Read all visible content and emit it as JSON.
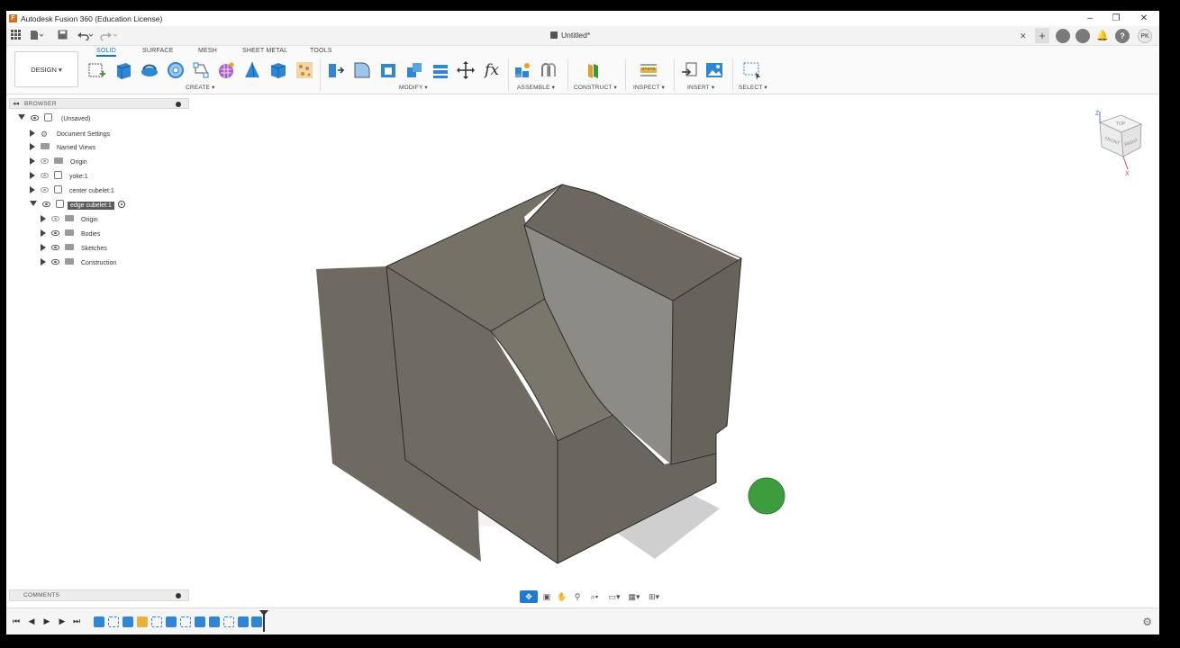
{
  "titlebar": {
    "app_icon_letter": "F",
    "title": "Autodesk Fusion 360 (Education License)",
    "minimize": "–",
    "restore": "❐",
    "close": "✕"
  },
  "quickbar": {
    "doc_title": "Untitled*",
    "close_tab": "✕",
    "new_tab": "+",
    "avatar": "PK"
  },
  "ribbon": {
    "workspace": "DESIGN",
    "tabs": [
      "SOLID",
      "SURFACE",
      "MESH",
      "SHEET METAL",
      "TOOLS"
    ],
    "groups": {
      "create": "CREATE",
      "modify": "MODIFY",
      "assemble": "ASSEMBLE",
      "construct": "CONSTRUCT",
      "inspect": "INSPECT",
      "insert": "INSERT",
      "select": "SELECT"
    },
    "fx": "fx"
  },
  "browser": {
    "label": "BROWSER",
    "items": [
      {
        "label": "(Unsaved)"
      },
      {
        "label": "Document Settings"
      },
      {
        "label": "Named Views"
      },
      {
        "label": "Origin"
      },
      {
        "label": "yoke:1"
      },
      {
        "label": "center cubelet:1"
      },
      {
        "label": "edge cubelet:1"
      },
      {
        "label": "Origin"
      },
      {
        "label": "Bodies"
      },
      {
        "label": "Sketches"
      },
      {
        "label": "Construction"
      }
    ]
  },
  "viewcube": {
    "top": "TOP",
    "front": "FRONT",
    "right": "RIGHT",
    "axis_z": "Z",
    "axis_x": "X"
  },
  "comments": {
    "label": "COMMENTS"
  },
  "colors": {
    "accent": "#1573c9",
    "model_face_light": "#7d7a72",
    "model_face_dark": "#5e5a52",
    "status_green": "#3d9c3d"
  }
}
